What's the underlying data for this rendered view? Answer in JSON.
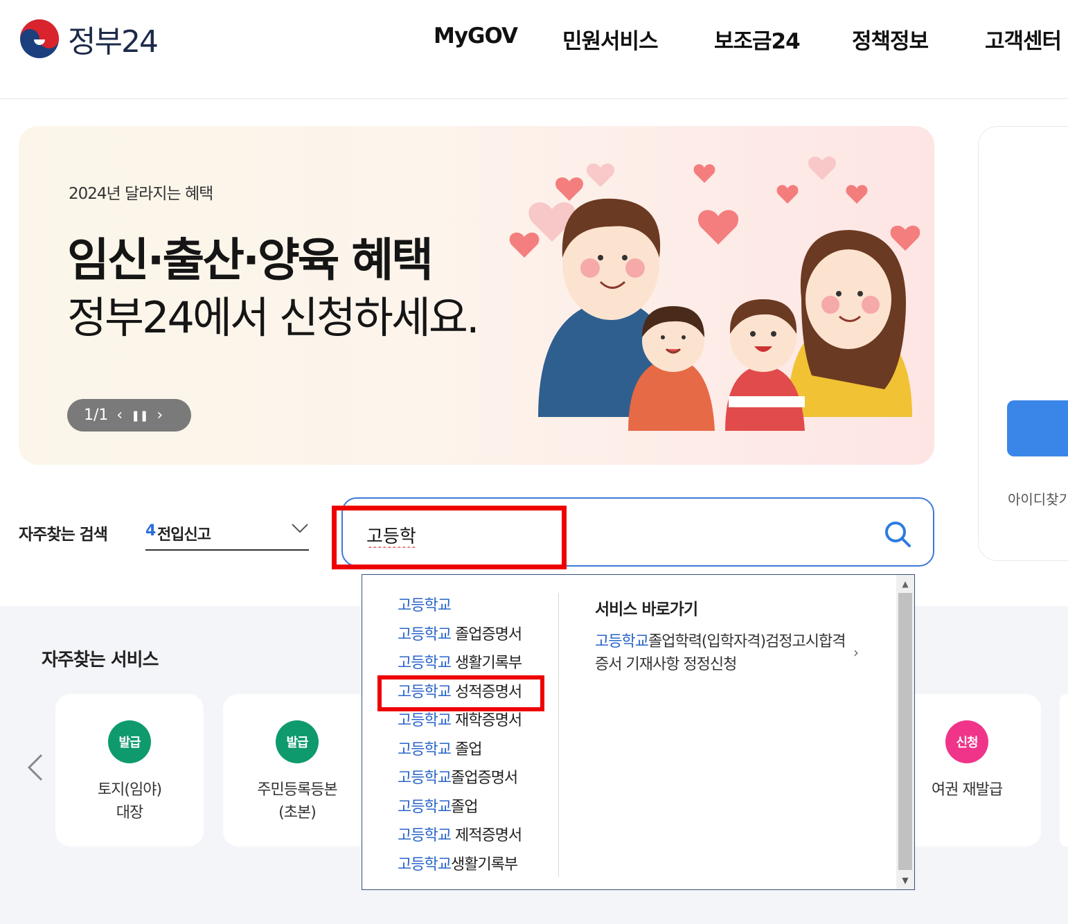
{
  "header": {
    "logo_text": "정부24",
    "nav": [
      "MyGOV",
      "민원서비스",
      "보조금24",
      "정책정보",
      "고객센터"
    ]
  },
  "banner": {
    "subtitle": "2024년 달라지는 혜택",
    "title": "임신·출산·양육 혜택",
    "title2": "정부24에서 신청하세요.",
    "counter": "1/1"
  },
  "login": {
    "find_id": "아이디찾기"
  },
  "frequent_search": {
    "label": "자주찾는 검색",
    "rank": "4",
    "keyword": "전입신고"
  },
  "search": {
    "value": "고등학"
  },
  "autocomplete": {
    "suggestions": [
      {
        "hl": "고등학교",
        "rest": ""
      },
      {
        "hl": "고등학교",
        "rest": " 졸업증명서"
      },
      {
        "hl": "고등학교",
        "rest": " 생활기록부"
      },
      {
        "hl": "고등학교",
        "rest": " 성적증명서"
      },
      {
        "hl": "고등학교",
        "rest": " 재학증명서"
      },
      {
        "hl": "고등학교",
        "rest": " 졸업"
      },
      {
        "hl": "고등학교",
        "rest": "졸업증명서"
      },
      {
        "hl": "고등학교",
        "rest": "졸업"
      },
      {
        "hl": "고등학교",
        "rest": " 제적증명서"
      },
      {
        "hl": "고등학교",
        "rest": "생활기록부"
      }
    ],
    "shortcut_title": "서비스 바로가기",
    "shortcut": {
      "hl": "고등학교",
      "rest": "졸업학력(입학자격)검정고시합격증서 기재사항 정정신청"
    }
  },
  "services": {
    "title": "자주찾는 서비스",
    "cards": [
      {
        "badge": "발급",
        "label": "토지(임야)\n대장",
        "color": "#0f9a6e"
      },
      {
        "badge": "발급",
        "label": "주민등록등본\n(초본)",
        "color": "#0f9a6e"
      },
      {
        "badge": "신청",
        "label": "여권 재발급",
        "color": "#f0348a"
      }
    ]
  },
  "colors": {
    "accent_blue": "#2864c8",
    "highlight_red": "#ee0000"
  }
}
